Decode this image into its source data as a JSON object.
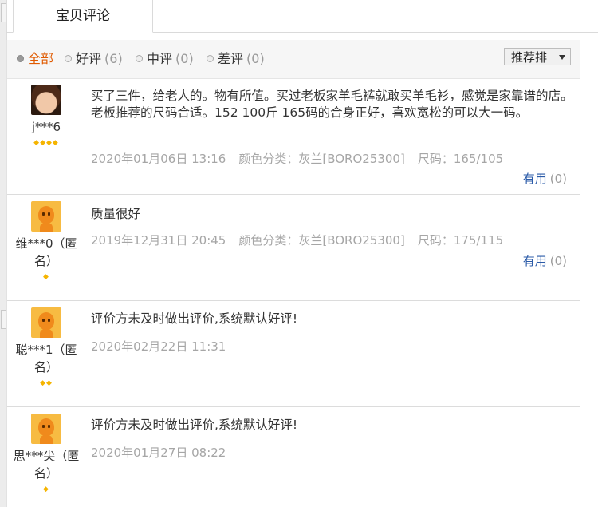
{
  "tab": {
    "label": "宝贝评论"
  },
  "filters": [
    {
      "label": "全部",
      "count": "",
      "selected": true
    },
    {
      "label": "好评",
      "count": "(6)",
      "selected": false
    },
    {
      "label": "中评",
      "count": "(0)",
      "selected": false
    },
    {
      "label": "差评",
      "count": "(0)",
      "selected": false
    }
  ],
  "sort": {
    "label": "推荐排"
  },
  "reviews": [
    {
      "user": "j***6",
      "level": "◆◆◆◆",
      "avatar": "photo",
      "text": "买了三件，给老人的。物有所值。买过老板家羊毛裤就敢买羊毛衫，感觉是家靠谱的店。老板推荐的尺码合适。152 100斤 165码的合身正好，喜欢宽松的可以大一码。",
      "date": "2020年01月06日 13:16",
      "color": "颜色分类：灰兰[BORO25300]",
      "size": "尺码：165/105",
      "useful_label": "有用",
      "useful_count": "(0)"
    },
    {
      "user": "维***0（匿名）",
      "level": "◆",
      "avatar": "default",
      "text": "质量很好",
      "date": "2019年12月31日 20:45",
      "color": "颜色分类：灰兰[BORO25300]",
      "size": "尺码：175/115",
      "useful_label": "有用",
      "useful_count": "(0)"
    },
    {
      "user": "聪***1（匿名）",
      "level": "◆◆",
      "avatar": "default",
      "text": "评价方未及时做出评价,系统默认好评!",
      "date": "2020年02月22日 11:31",
      "color": "",
      "size": "",
      "useful_label": "",
      "useful_count": ""
    },
    {
      "user": "思***尖（匿名）",
      "level": "◆",
      "avatar": "default",
      "text": "评价方未及时做出评价,系统默认好评!",
      "date": "2020年01月27日 08:22",
      "color": "",
      "size": "",
      "useful_label": "",
      "useful_count": ""
    }
  ]
}
